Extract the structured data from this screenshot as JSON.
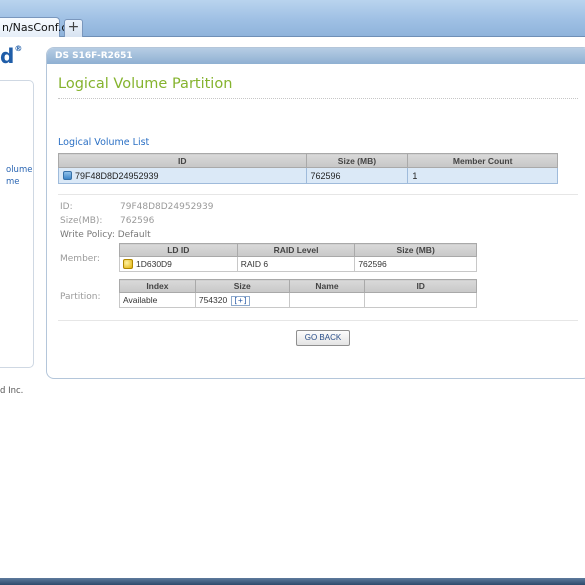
{
  "browser": {
    "tab_label": "n/NasConf.cgi",
    "new_tab_symbol": "+"
  },
  "sidebar": {
    "brand": "d",
    "brand_mark": "®",
    "items": [
      "olume",
      "me"
    ],
    "copyright": "d Inc."
  },
  "main": {
    "header": "DS S16F-R2651",
    "page_title": "Logical Volume Partition",
    "list_title": "Logical Volume List",
    "vol_table": {
      "columns": [
        "ID",
        "Size (MB)",
        "Member Count"
      ],
      "rows": [
        {
          "id": "79F48D8D24952939",
          "size": "762596",
          "members": "1"
        }
      ]
    },
    "details": {
      "id_label": "ID:",
      "id_value": "79F48D8D24952939",
      "size_label": "Size(MB):",
      "size_value": "762596",
      "write_policy": "Write Policy: Default",
      "member_label": "Member:",
      "partition_label": "Partition:"
    },
    "member_table": {
      "columns": [
        "LD ID",
        "RAID Level",
        "Size (MB)"
      ],
      "rows": [
        {
          "ld_id": "1D630D9",
          "raid": "RAID 6",
          "size": "762596"
        }
      ]
    },
    "partition_table": {
      "columns": [
        "Index",
        "Size",
        "Name",
        "ID"
      ],
      "rows": [
        {
          "index": "Available",
          "size": "754320",
          "expand": "[+]",
          "name": "",
          "id": ""
        }
      ]
    },
    "go_back_label": "GO BACK"
  },
  "colors": {
    "title_green": "#85b32e",
    "link_blue": "#2a6fc4",
    "header_blue": "#8fb0d2"
  }
}
